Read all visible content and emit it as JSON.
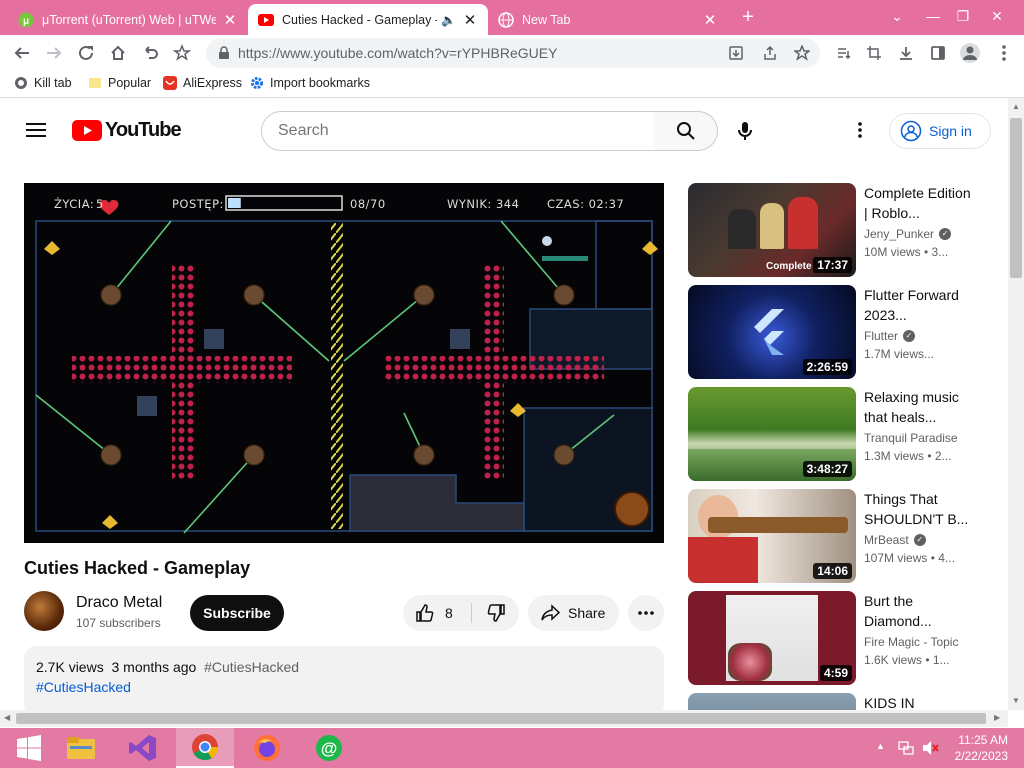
{
  "browser": {
    "tabs": [
      {
        "title": "μTorrent (uTorrent) Web | uTWeb"
      },
      {
        "title": "Cuties Hacked - Gameplay -"
      },
      {
        "title": "New Tab"
      }
    ],
    "new_tab_label": "+",
    "url": "https://www.youtube.com/watch?v=rYPHBReGUEY",
    "bookmarks": [
      "Kill tab",
      "Popular",
      "AliExpress",
      "Import bookmarks"
    ]
  },
  "youtube": {
    "logo_text": "YouTube",
    "search_placeholder": "Search",
    "signin_label": "Sign in"
  },
  "game_hud": {
    "lives_label": "ŻYCIA:",
    "lives_value": "5",
    "progress_label": "POSTĘP:",
    "progress_value": "08/70",
    "progress_fraction": 0.114,
    "score_label": "WYNIK: 344",
    "time_label": "CZAS: 02:37"
  },
  "video": {
    "title": "Cuties Hacked - Gameplay",
    "channel": "Draco Metal",
    "subscribers": "107 subscribers",
    "subscribe_label": "Subscribe",
    "likes": "8",
    "share_label": "Share",
    "views": "2.7K views",
    "age": "3 months ago",
    "hashtag_inline": "#CutiesHacked",
    "hashtag_link": "#CutiesHacked"
  },
  "recommendations": [
    {
      "title": "Complete Edition | Roblo...",
      "channel": "Jeny_Punker",
      "verified": true,
      "views": "10M views • 3...",
      "duration": "17:37",
      "thumb_text": "Complete"
    },
    {
      "title": "Flutter Forward 2023...",
      "channel": "Flutter",
      "verified": true,
      "views": "1.7M views...",
      "duration": "2:26:59"
    },
    {
      "title": "Relaxing music that heals...",
      "channel": "Tranquil Paradise",
      "verified": false,
      "views": "1.3M views • 2...",
      "duration": "3:48:27"
    },
    {
      "title": "Things That SHOULDN'T B...",
      "channel": "MrBeast",
      "verified": true,
      "views": "107M views • 4...",
      "duration": "14:06"
    },
    {
      "title": "Burt the Diamond...",
      "channel": "Fire Magic - Topic",
      "verified": false,
      "views": "1.6K views • 1...",
      "duration": "4:59"
    },
    {
      "title": "KIDS IN",
      "channel": "",
      "verified": false,
      "views": "",
      "duration": ""
    }
  ],
  "taskbar": {
    "time": "11:25 AM",
    "date": "2/22/2023"
  }
}
